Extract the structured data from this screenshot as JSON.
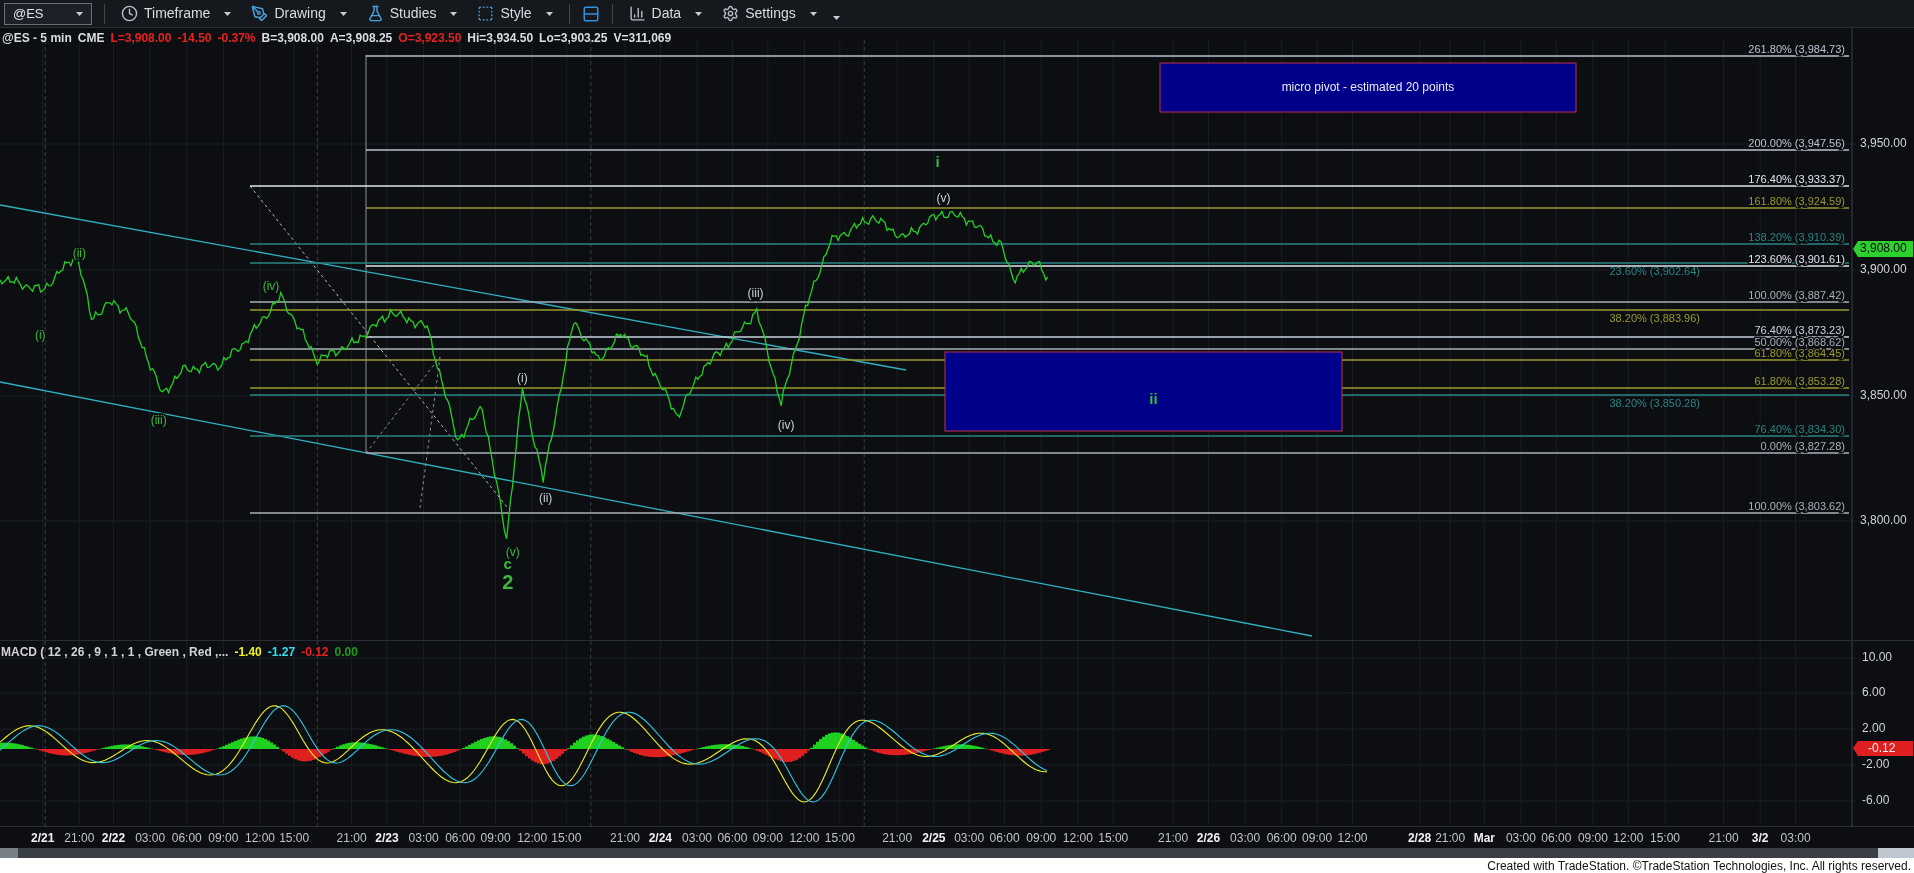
{
  "toolbar": {
    "symbol": "@ES",
    "items": [
      {
        "label": "Timeframe",
        "kind": "clock"
      },
      {
        "label": "Drawing",
        "kind": "pen"
      },
      {
        "label": "Studies",
        "kind": "flask"
      },
      {
        "label": "Style",
        "kind": "style"
      },
      {
        "kind": "layout"
      },
      {
        "label": "Data",
        "kind": "bars"
      },
      {
        "label": "Settings",
        "kind": "gear"
      }
    ]
  },
  "quote": [
    {
      "text": "@ES - 5 min",
      "color": "#d8dde3"
    },
    {
      "text": "CME",
      "color": "#d8dde3"
    },
    {
      "text": "L=3,908.00",
      "color": "#e52222"
    },
    {
      "text": "-14.50",
      "color": "#e52222"
    },
    {
      "text": "-0.37%",
      "color": "#e52222"
    },
    {
      "text": "B=3,908.00",
      "color": "#d8dde3"
    },
    {
      "text": "A=3,908.25",
      "color": "#d8dde3"
    },
    {
      "text": "O=3,923.50",
      "color": "#e52222"
    },
    {
      "text": "Hi=3,934.50",
      "color": "#d8dde3"
    },
    {
      "text": "Lo=3,903.25",
      "color": "#d8dde3"
    },
    {
      "text": "V=311,069",
      "color": "#d8dde3"
    }
  ],
  "fib_levels": [
    {
      "label": "261.80% (3,984.73)",
      "color": "#b8c4d0"
    },
    {
      "label": "200.00% (3,947.56)",
      "color": "#b8c4d0"
    },
    {
      "label": "176.40% (3,933.37)",
      "color": "#dfe6ee"
    },
    {
      "label": "161.80% (3,924.59)",
      "color": "#9a9a30"
    },
    {
      "label": "138.20% (3,910.39)",
      "color": "#2a8585"
    },
    {
      "label": "23.60% (3,902.64)",
      "color": "#2a8585"
    },
    {
      "label": "123.60% (3,901.61)",
      "color": "#dfe6ee"
    },
    {
      "label": "100.00% (3,887.42)",
      "color": "#a8b0b8"
    },
    {
      "label": "38.20% (3,883.96)",
      "color": "#9a9a30"
    },
    {
      "label": "76.40% (3,873.23)",
      "color": "#c8d4e0"
    },
    {
      "label": "50.00% (3,868.62)",
      "color": "#a8b0b8"
    },
    {
      "label": "61.80% (3,864.45)",
      "color": "#9a9a30"
    },
    {
      "label": "61.80% (3,853.28)",
      "color": "#9a9a30"
    },
    {
      "label": "38.20% (3,850.28)",
      "color": "#2a8585"
    },
    {
      "label": "76.40% (3,834.30)",
      "color": "#2a8585"
    },
    {
      "label": "0.00% (3,827.28)",
      "color": "#a8b0b8"
    },
    {
      "label": "100.00% (3,803.62)",
      "color": "#a8b0b8"
    }
  ],
  "wave_labels": [
    {
      "text": "(i)",
      "kind": "minor",
      "color": "#3cb83c"
    },
    {
      "text": "(ii)",
      "kind": "minor",
      "color": "#3cb83c"
    },
    {
      "text": "(iii)",
      "kind": "minor",
      "color": "#3cb83c"
    },
    {
      "text": "(iv)",
      "kind": "minor",
      "color": "#3cb83c"
    },
    {
      "text": "(v)",
      "kind": "minor",
      "color": "#3cb83c"
    },
    {
      "text": "c",
      "kind": "major",
      "color": "#3cb83c"
    },
    {
      "text": "2",
      "kind": "major",
      "color": "#3cb83c"
    },
    {
      "text": "(i)",
      "kind": "minor",
      "color": "#c8d0d8"
    },
    {
      "text": "(ii)",
      "kind": "minor",
      "color": "#c8d0d8"
    },
    {
      "text": "(iii)",
      "kind": "minor",
      "color": "#c8d0d8"
    },
    {
      "text": "(iv)",
      "kind": "minor",
      "color": "#c8d0d8"
    },
    {
      "text": "(v)",
      "kind": "minor",
      "color": "#c8d0d8"
    },
    {
      "text": "i",
      "kind": "major",
      "color": "#3cb83c"
    },
    {
      "text": "ii",
      "kind": "major",
      "color": "#3cb83c"
    }
  ],
  "pivot_box": {
    "text": "micro pivot - estimated 20 points"
  },
  "price_axis": [
    "3,950.00",
    "3,900.00",
    "3,850.00",
    "3,800.00"
  ],
  "last_price": "3,908.00",
  "macd": {
    "title": "MACD ( 12 , 26 , 9 , 1 , 1 , Green , Red ,...",
    "values": [
      {
        "text": "-1.40",
        "color": "#f0f020"
      },
      {
        "text": "-1.27",
        "color": "#30e0f0"
      },
      {
        "text": "-0.12",
        "color": "#e52222"
      },
      {
        "text": "0.00",
        "color": "#1f9a1f"
      }
    ],
    "axis": [
      "10.00",
      "6.00",
      "2.00",
      "-2.00",
      "-6.00"
    ],
    "last_value": "-0.12"
  },
  "x_axis": [
    {
      "text": "2/21",
      "kind": "date"
    },
    {
      "text": "21:00",
      "kind": "time"
    },
    {
      "text": "2/22",
      "kind": "date"
    },
    {
      "text": "03:00",
      "kind": "time"
    },
    {
      "text": "06:00",
      "kind": "time"
    },
    {
      "text": "09:00",
      "kind": "time"
    },
    {
      "text": "12:00",
      "kind": "time"
    },
    {
      "text": "15:00",
      "kind": "time"
    },
    {
      "text": "21:00",
      "kind": "time"
    },
    {
      "text": "2/23",
      "kind": "date"
    },
    {
      "text": "03:00",
      "kind": "time"
    },
    {
      "text": "06:00",
      "kind": "time"
    },
    {
      "text": "09:00",
      "kind": "time"
    },
    {
      "text": "12:00",
      "kind": "time"
    },
    {
      "text": "15:00",
      "kind": "time"
    },
    {
      "text": "21:00",
      "kind": "time"
    },
    {
      "text": "2/24",
      "kind": "date"
    },
    {
      "text": "03:00",
      "kind": "time"
    },
    {
      "text": "06:00",
      "kind": "time"
    },
    {
      "text": "09:00",
      "kind": "time"
    },
    {
      "text": "12:00",
      "kind": "time"
    },
    {
      "text": "15:00",
      "kind": "time"
    },
    {
      "text": "21:00",
      "kind": "time"
    },
    {
      "text": "2/25",
      "kind": "date"
    },
    {
      "text": "03:00",
      "kind": "time"
    },
    {
      "text": "06:00",
      "kind": "time"
    },
    {
      "text": "09:00",
      "kind": "time"
    },
    {
      "text": "12:00",
      "kind": "time"
    },
    {
      "text": "15:00",
      "kind": "time"
    },
    {
      "text": "21:00",
      "kind": "time"
    },
    {
      "text": "2/26",
      "kind": "date"
    },
    {
      "text": "03:00",
      "kind": "time"
    },
    {
      "text": "06:00",
      "kind": "time"
    },
    {
      "text": "09:00",
      "kind": "time"
    },
    {
      "text": "12:00",
      "kind": "time"
    },
    {
      "text": "2/28",
      "kind": "date"
    },
    {
      "text": "21:00",
      "kind": "time"
    },
    {
      "text": "Mar",
      "kind": "date"
    },
    {
      "text": "03:00",
      "kind": "time"
    },
    {
      "text": "06:00",
      "kind": "time"
    },
    {
      "text": "09:00",
      "kind": "time"
    },
    {
      "text": "12:00",
      "kind": "time"
    },
    {
      "text": "15:00",
      "kind": "time"
    },
    {
      "text": "21:00",
      "kind": "time"
    },
    {
      "text": "3/2",
      "kind": "date"
    },
    {
      "text": "03:00",
      "kind": "time"
    }
  ],
  "footer": "Created with TradeStation. ©TradeStation Technologies, Inc. All rights reserved."
}
